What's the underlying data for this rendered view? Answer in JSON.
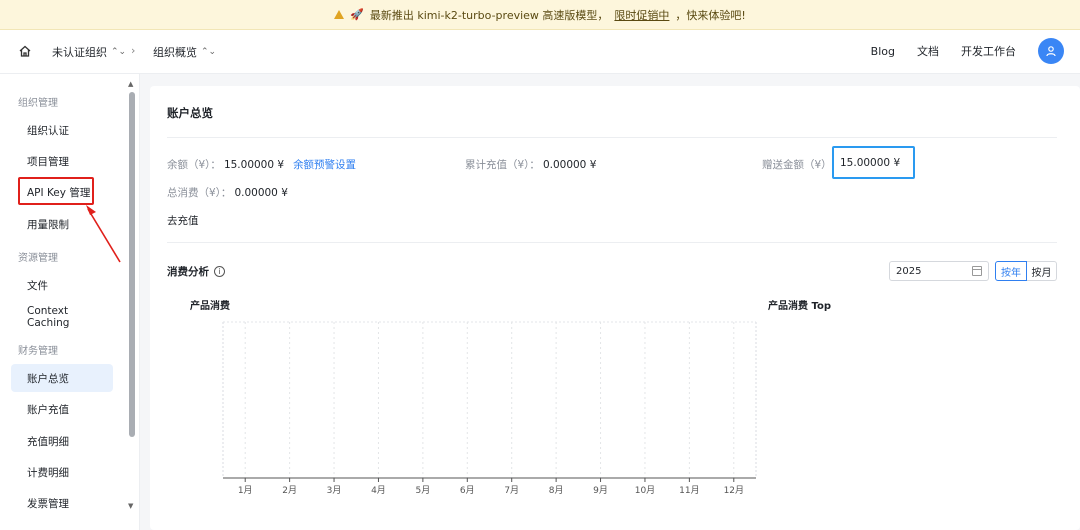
{
  "banner": {
    "text_before": "最新推出 kimi-k2-turbo-preview 高速版模型，",
    "link": "限时促销中",
    "text_after": "，快来体验吧!"
  },
  "header": {
    "org": "未认证组织",
    "page": "组织概览",
    "nav": [
      "Blog",
      "文档",
      "开发工作台"
    ]
  },
  "sidebar": {
    "sections": [
      {
        "label": "组织管理",
        "items": [
          "组织认证",
          "项目管理",
          "API Key 管理",
          "用量限制"
        ]
      },
      {
        "label": "资源管理",
        "items": [
          "文件",
          "Context Caching"
        ]
      },
      {
        "label": "财务管理",
        "items": [
          "账户总览",
          "账户充值",
          "充值明细",
          "计费明细",
          "发票管理"
        ]
      }
    ],
    "active": "账户总览"
  },
  "account": {
    "title": "账户总览",
    "balance_label": "余额（¥）：",
    "balance_value": "15.00000 ¥",
    "alert_link": "余额预警设置",
    "total_recharge_label": "累计充值（¥）：",
    "total_recharge_value": "0.00000 ¥",
    "gift_label": "赠送金额（¥）",
    "gift_value": "15.00000 ¥",
    "total_spend_label": "总消费（¥）：",
    "total_spend_value": "0.00000 ¥",
    "recharge_link": "去充值"
  },
  "analysis": {
    "title": "消费分析",
    "year": "2025",
    "toggle_year": "按年",
    "toggle_month": "按月",
    "product_spend": "产品消费",
    "product_top": "产品消费 Top"
  },
  "chart_data": {
    "type": "bar",
    "categories": [
      "1月",
      "2月",
      "3月",
      "4月",
      "5月",
      "6月",
      "7月",
      "8月",
      "9月",
      "10月",
      "11月",
      "12月"
    ],
    "values": [
      0,
      0,
      0,
      0,
      0,
      0,
      0,
      0,
      0,
      0,
      0,
      0
    ],
    "grid": true
  }
}
